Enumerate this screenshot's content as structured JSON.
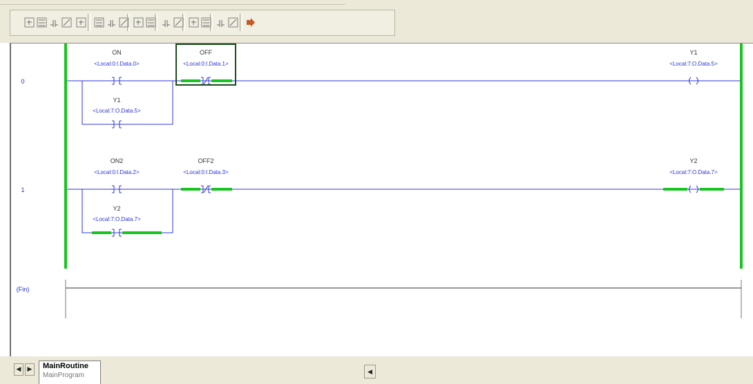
{
  "toolbar": {
    "buttons": [
      {
        "name": "new-element-icon"
      },
      {
        "name": "add-branch-icon"
      },
      {
        "name": "insert-rung-icon"
      },
      {
        "name": "move-element-icon"
      },
      {
        "name": "grid-icon"
      },
      {
        "name": "xic-contact-icon"
      },
      {
        "name": "xio-contact-icon"
      },
      {
        "name": "ote-coil-icon"
      },
      {
        "name": "otl-coil-icon"
      },
      {
        "name": "otu-coil-icon"
      },
      {
        "name": "verify-rung-icon"
      },
      {
        "name": "verify-all-icon"
      },
      {
        "name": "accept-edits-icon"
      },
      {
        "name": "cancel-edits-icon"
      },
      {
        "name": "finalize-edits-icon"
      },
      {
        "name": "test-edits-icon"
      },
      {
        "name": "forward-arrow-icon"
      }
    ]
  },
  "ladder": {
    "rungs": [
      {
        "number": "0",
        "instructions": [
          {
            "type": "XIC",
            "symbol": "] [",
            "name": "ON",
            "address": "<Local:0:I.Data.0>",
            "energized": false,
            "selected": false
          },
          {
            "type": "XIO",
            "symbol": "]/[",
            "name": "OFF",
            "address": "<Local:0:I.Data.1>",
            "energized": true,
            "selected": true
          },
          {
            "type": "OTE",
            "symbol": "( )",
            "name": "Y1",
            "address": "<Local:7:O.Data.5>",
            "energized": false,
            "selected": false
          }
        ],
        "branch": {
          "type": "XIC",
          "symbol": "] [",
          "name": "Y1",
          "address": "<Local:7:O.Data.5>",
          "energized": false
        }
      },
      {
        "number": "1",
        "instructions": [
          {
            "type": "XIC",
            "symbol": "] [",
            "name": "ON2",
            "address": "<Local:0:I.Data.2>",
            "energized": false,
            "selected": false
          },
          {
            "type": "XIO",
            "symbol": "]/[",
            "name": "OFF2",
            "address": "<Local:0:I.Data.3>",
            "energized": true,
            "selected": false
          },
          {
            "type": "OTE",
            "symbol": "( )",
            "name": "Y2",
            "address": "<Local:7:O.Data.7>",
            "energized": true,
            "selected": false
          }
        ],
        "branch": {
          "type": "XIC",
          "symbol": "] [",
          "name": "Y2",
          "address": "<Local:7:O.Data.7>",
          "energized": true
        }
      }
    ],
    "end_label": "(Fin)",
    "colors": {
      "rung": "#2b34d4",
      "power": "#18c420",
      "text": "#2b34d4",
      "rung_number": "#1f2bd0",
      "end": "#333333",
      "selection": "#1a4a1a"
    }
  },
  "tabs": {
    "routine": "MainRoutine",
    "program": "MainProgram"
  }
}
